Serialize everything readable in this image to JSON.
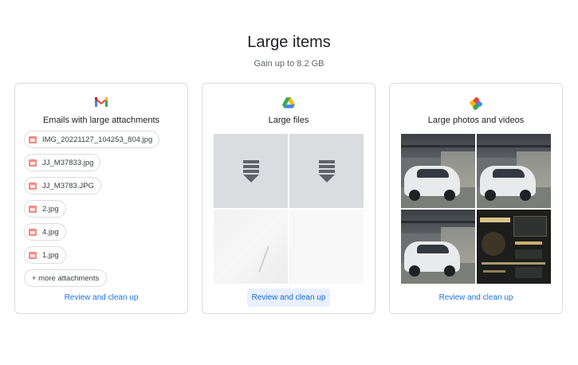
{
  "header": {
    "title": "Large items",
    "subtitle": "Gain up to 8.2 GB"
  },
  "cards": {
    "gmail": {
      "icon": "gmail-icon",
      "title": "Emails with large attachments",
      "attachments": [
        "IMG_20221127_104253_804.jpg",
        "JJ_M37833.jpg",
        "JJ_M3783.JPG",
        "2.jpg",
        "4.jpg",
        "1.jpg"
      ],
      "more_label": "+ more attachments",
      "action": "Review and clean up"
    },
    "drive": {
      "icon": "google-drive-icon",
      "title": "Large files",
      "action": "Review and clean up"
    },
    "photos": {
      "icon": "google-photos-icon",
      "title": "Large photos and videos",
      "action": "Review and clean up"
    }
  },
  "colors": {
    "accent": "#1a73e8",
    "border": "#dadce0",
    "highlight_bg": "#e8f0fe"
  }
}
